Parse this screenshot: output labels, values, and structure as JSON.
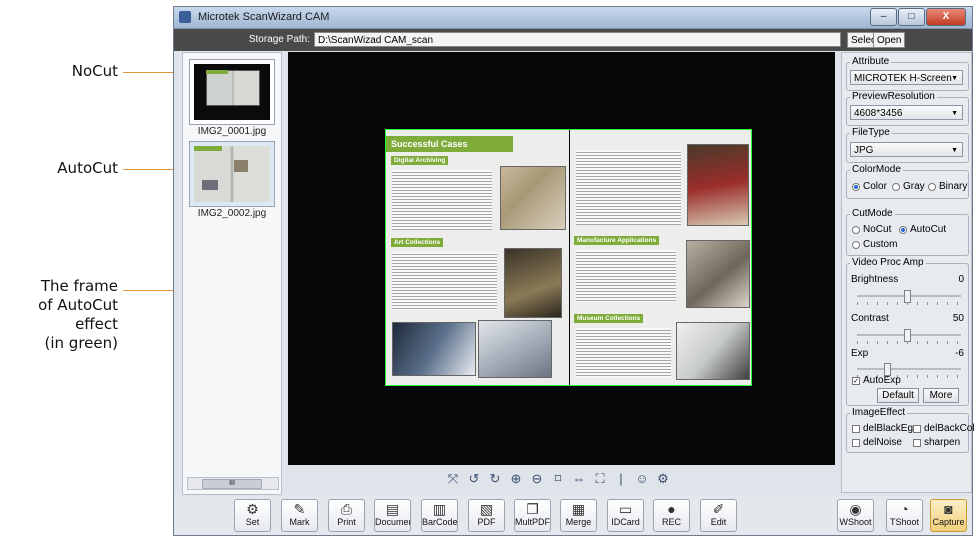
{
  "annotations": {
    "nocut": "NoCut",
    "autocut": "AutoCut",
    "frame_lines": [
      "The frame",
      "of AutoCut",
      "effect",
      "(in green)"
    ]
  },
  "window": {
    "title": "Microtek ScanWizard CAM",
    "controls": [
      "–",
      "□",
      "X"
    ]
  },
  "storage": {
    "label": "Storage Path:",
    "value": "D:\\ScanWizad CAM_scan",
    "select_label": "Select",
    "open_label": "Open"
  },
  "thumbnails": [
    {
      "name": "IMG2_0001.jpg"
    },
    {
      "name": "IMG2_0002.jpg"
    }
  ],
  "scrollbar_grip": "III",
  "document": {
    "title": "Successful Cases",
    "sections": [
      "Digital Archiving",
      "Art Collections",
      "Manufacture Applications",
      "Museum Collections"
    ]
  },
  "preview_tools": [
    {
      "icon": "fit-icon",
      "glyph": "⤧"
    },
    {
      "icon": "rotate-left-icon",
      "glyph": "↺"
    },
    {
      "icon": "rotate-right-icon",
      "glyph": "↻"
    },
    {
      "icon": "zoom-in-icon",
      "glyph": "⊕"
    },
    {
      "icon": "zoom-out-icon",
      "glyph": "⊖"
    },
    {
      "icon": "crop-icon",
      "glyph": "⌑"
    },
    {
      "icon": "flip-icon",
      "glyph": "⇔"
    },
    {
      "icon": "select-area-icon",
      "glyph": "⛶"
    },
    {
      "icon": "separator",
      "glyph": "|"
    },
    {
      "icon": "face-detect-icon",
      "glyph": "☺"
    },
    {
      "icon": "settings-camera-icon",
      "glyph": "⚙"
    }
  ],
  "panel": {
    "attribute": {
      "label": "Attribute",
      "value": "MICROTEK H-Screen"
    },
    "preview_resolution": {
      "label": "PreviewResolution",
      "value": "4608*3456"
    },
    "file_type": {
      "label": "FileType",
      "value": "JPG"
    },
    "color_mode": {
      "label": "ColorMode",
      "options": [
        "Color",
        "Gray",
        "Binary"
      ],
      "selected": "Color"
    },
    "cut_mode": {
      "label": "CutMode",
      "options": [
        "NoCut",
        "AutoCut",
        "Custom"
      ],
      "selected": "AutoCut"
    },
    "video": {
      "label": "Video Proc Amp",
      "brightness": {
        "label": "Brightness",
        "value": "0",
        "level": 0.5
      },
      "contrast": {
        "label": "Contrast",
        "value": "50",
        "level": 0.5
      },
      "exp": {
        "label": "Exp",
        "value": "-6",
        "level": 0.3
      },
      "autoexp_label": "AutoExp",
      "autoexp_checked": true,
      "default_label": "Default",
      "more_label": "More"
    },
    "image_effect": {
      "label": "ImageEffect",
      "options": [
        "delBlackEg",
        "delBackCol",
        "delNoise",
        "sharpen"
      ]
    }
  },
  "toolbar": [
    {
      "label": "Set",
      "icon": "gear-icon",
      "glyph": "⚙"
    },
    {
      "label": "Mark",
      "icon": "marker-icon",
      "glyph": "✎"
    },
    {
      "label": "Print",
      "icon": "printer-icon",
      "glyph": "⎙"
    },
    {
      "label": "Documen",
      "icon": "document-icon",
      "glyph": "▤"
    },
    {
      "label": "BarCode",
      "icon": "barcode-icon",
      "glyph": "▥"
    },
    {
      "label": "PDF",
      "icon": "pdf-icon",
      "glyph": "▧"
    },
    {
      "label": "MultPDF",
      "icon": "multi-pdf-icon",
      "glyph": "❐"
    },
    {
      "label": "Merge",
      "icon": "merge-icon",
      "glyph": "▦"
    },
    {
      "label": "IDCard",
      "icon": "id-card-icon",
      "glyph": "▭"
    },
    {
      "label": "REC",
      "icon": "record-icon",
      "glyph": "●"
    },
    {
      "label": "Edit",
      "icon": "edit-icon",
      "glyph": "✐"
    }
  ],
  "toolbar_right": [
    {
      "label": "WShoot",
      "icon": "webcam-shoot-icon",
      "glyph": "◉"
    },
    {
      "label": "TShoot",
      "icon": "timer-shoot-icon",
      "glyph": "◔"
    },
    {
      "label": "Capture",
      "icon": "capture-icon",
      "glyph": "◙",
      "active": true
    }
  ]
}
